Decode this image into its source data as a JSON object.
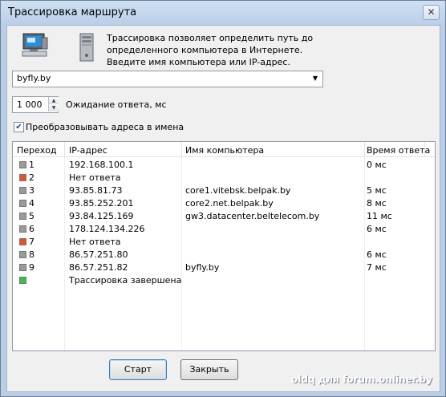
{
  "window": {
    "title": "Трассировка маршрута",
    "close_glyph": "✕"
  },
  "intro": {
    "lines": [
      "Трассировка позволяет определить путь до",
      "определенного компьютера в Интернете.",
      "Введите имя компьютера или IP-адрес."
    ]
  },
  "target": {
    "value": "byfly.by"
  },
  "timeout": {
    "value": "1 000",
    "label": "Ожидание ответа, мс"
  },
  "resolve": {
    "checked": true,
    "label": "Преобразовывать адреса в имена"
  },
  "table": {
    "headers": [
      "Переход",
      "IP-адрес",
      "Имя компьютера",
      "Время ответа"
    ],
    "rows": [
      {
        "hop": "1",
        "ip": "192.168.100.1",
        "host": "",
        "time": "0 мс",
        "status": "ok"
      },
      {
        "hop": "2",
        "ip": "Нет ответа",
        "host": "",
        "time": "",
        "status": "timeout"
      },
      {
        "hop": "3",
        "ip": "93.85.81.73",
        "host": "core1.vitebsk.belpak.by",
        "time": "5 мс",
        "status": "ok"
      },
      {
        "hop": "4",
        "ip": "93.85.252.201",
        "host": "core2.net.belpak.by",
        "time": "8 мс",
        "status": "ok"
      },
      {
        "hop": "5",
        "ip": "93.84.125.169",
        "host": "gw3.datacenter.beltelecom.by",
        "time": "11 мс",
        "status": "ok"
      },
      {
        "hop": "6",
        "ip": "178.124.134.226",
        "host": "",
        "time": "6 мс",
        "status": "ok"
      },
      {
        "hop": "7",
        "ip": "Нет ответа",
        "host": "",
        "time": "",
        "status": "timeout"
      },
      {
        "hop": "8",
        "ip": "86.57.251.80",
        "host": "",
        "time": "6 мс",
        "status": "ok"
      },
      {
        "hop": "9",
        "ip": "86.57.251.82",
        "host": "byfly.by",
        "time": "7 мс",
        "status": "ok"
      },
      {
        "hop": "",
        "ip": "Трассировка завершена",
        "host": "",
        "time": "",
        "status": "done"
      }
    ]
  },
  "buttons": {
    "start": "Старт",
    "close": "Закрыть"
  },
  "watermark": "oldq для forum.onliner.by",
  "colors": {
    "ok": "#9a9a9a",
    "timeout": "#e8502a",
    "done": "#39c23a"
  }
}
